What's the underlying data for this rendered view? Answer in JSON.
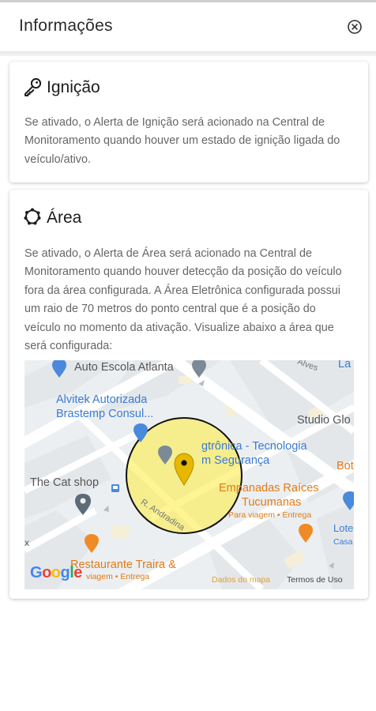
{
  "header": {
    "title": "Informações",
    "close_icon": "close-circle-icon"
  },
  "ignicao": {
    "icon": "key-icon",
    "title": "Ignição",
    "description": "Se ativado, o Alerta de Ignição será acionado na Central de Monitoramento quando houver um estado de ignição ligada do veículo/ativo."
  },
  "area": {
    "icon": "geofence-polygon-icon",
    "title": "Área",
    "description": "Se ativado, o Alerta de Área será acionado na Central de Monitoramento quando houver detecção da posição do veículo fora da área configurada. A Área Eletrônica configurada possui um raio de 70 metros do ponto central que é a posição do veículo no momento da ativação. Visualize abaixo a área que será configurada:"
  },
  "map": {
    "labels": {
      "auto_escola": "Auto Escola Atlanta",
      "alvitek_1": "Alvitek Autorizada",
      "alvitek_2": "Brastemp Consul...",
      "tecnologia_1": "gtrônica - Tecnologia",
      "tecnologia_2": "m Segurança",
      "studio": "Studio Glo",
      "bot": "Bot",
      "cat_shop": "The Cat shop",
      "empanadas_1": "Empanadas Raíces",
      "empanadas_2": "Tucumanas",
      "empanadas_sub": "Para viagem • Entrega",
      "lote_1": "Lote",
      "lote_2": "Casa",
      "restaurante": "Restaurante Traira &",
      "restaurante_sub": "viagem • Entrega",
      "alves": "Alves",
      "la": "La",
      "r_andradina": "R. Andradina",
      "x_edge": "x",
      "google": "Google",
      "dados": "Dados do mapa",
      "termos": "Termos de Uso"
    },
    "circle_color": "#ffeb3b",
    "pin_color": "#e6b800"
  }
}
